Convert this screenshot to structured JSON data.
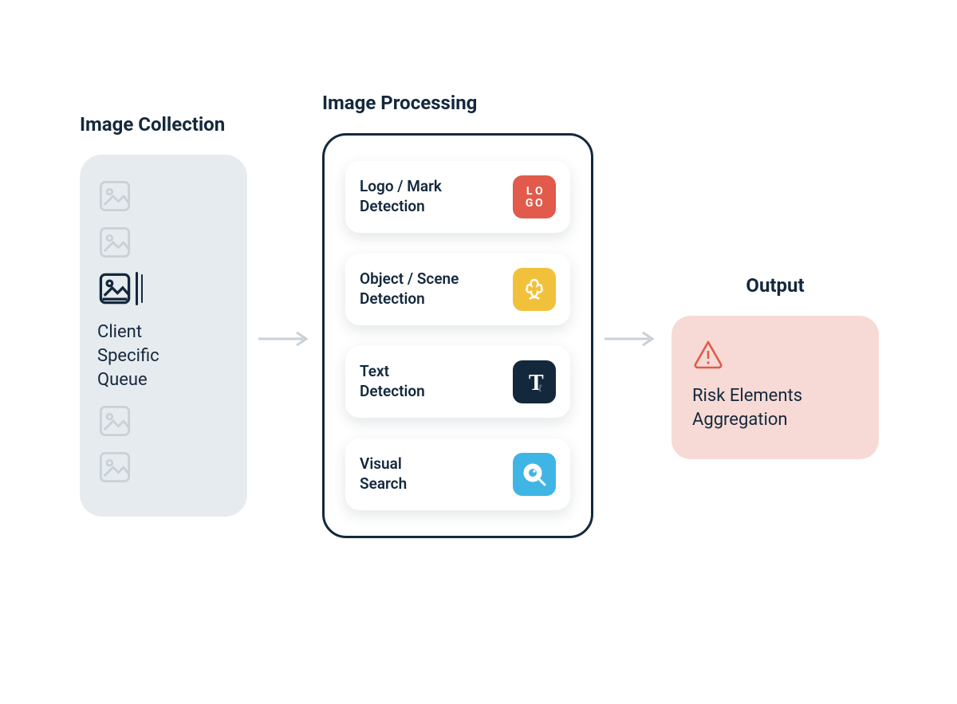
{
  "collection": {
    "title": "Image Collection",
    "queue_label": "Client\nSpecific\nQueue"
  },
  "processing": {
    "title": "Image Processing",
    "items": [
      {
        "label": "Logo / Mark\nDetection",
        "icon": "logo-icon"
      },
      {
        "label": "Object / Scene\nDetection",
        "icon": "flower-icon"
      },
      {
        "label": "Text\nDetection",
        "icon": "text-icon"
      },
      {
        "label": "Visual\nSearch",
        "icon": "lens-icon"
      }
    ]
  },
  "output": {
    "title": "Output",
    "label": "Risk Elements\nAggregation"
  }
}
